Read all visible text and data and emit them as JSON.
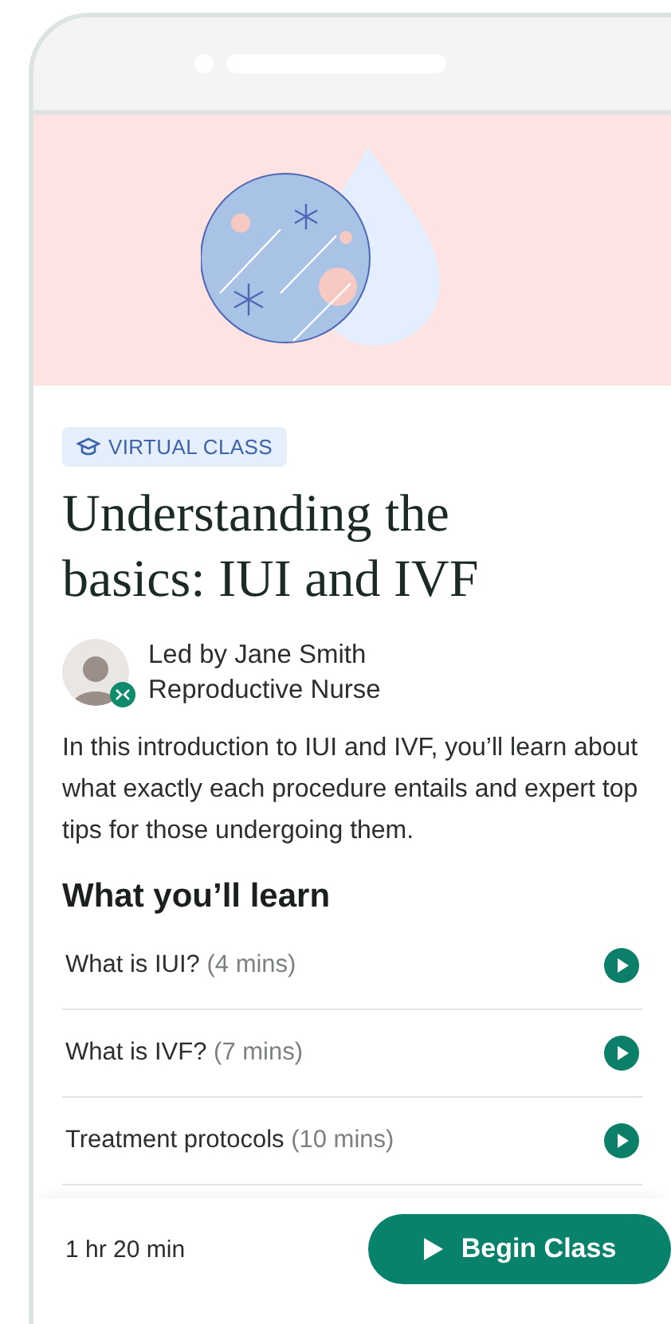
{
  "badge": {
    "label": "VIRTUAL CLASS"
  },
  "title": "Understanding the basics: IUI and IVF",
  "instructor": {
    "led_by": "Led by Jane Smith",
    "role": "Reproductive Nurse"
  },
  "description": "In this introduction to IUI and IVF, you’ll learn about what exactly each procedure entails and expert top tips for those undergoing them.",
  "section_title": "What you’ll learn",
  "lessons": [
    {
      "title": "What is IUI?",
      "duration": "(4 mins)"
    },
    {
      "title": "What is IVF?",
      "duration": "(7 mins)"
    },
    {
      "title": "Treatment protocols",
      "duration": "(10 mins)"
    }
  ],
  "footer": {
    "total_time": "1 hr 20 min",
    "button": "Begin Class"
  }
}
